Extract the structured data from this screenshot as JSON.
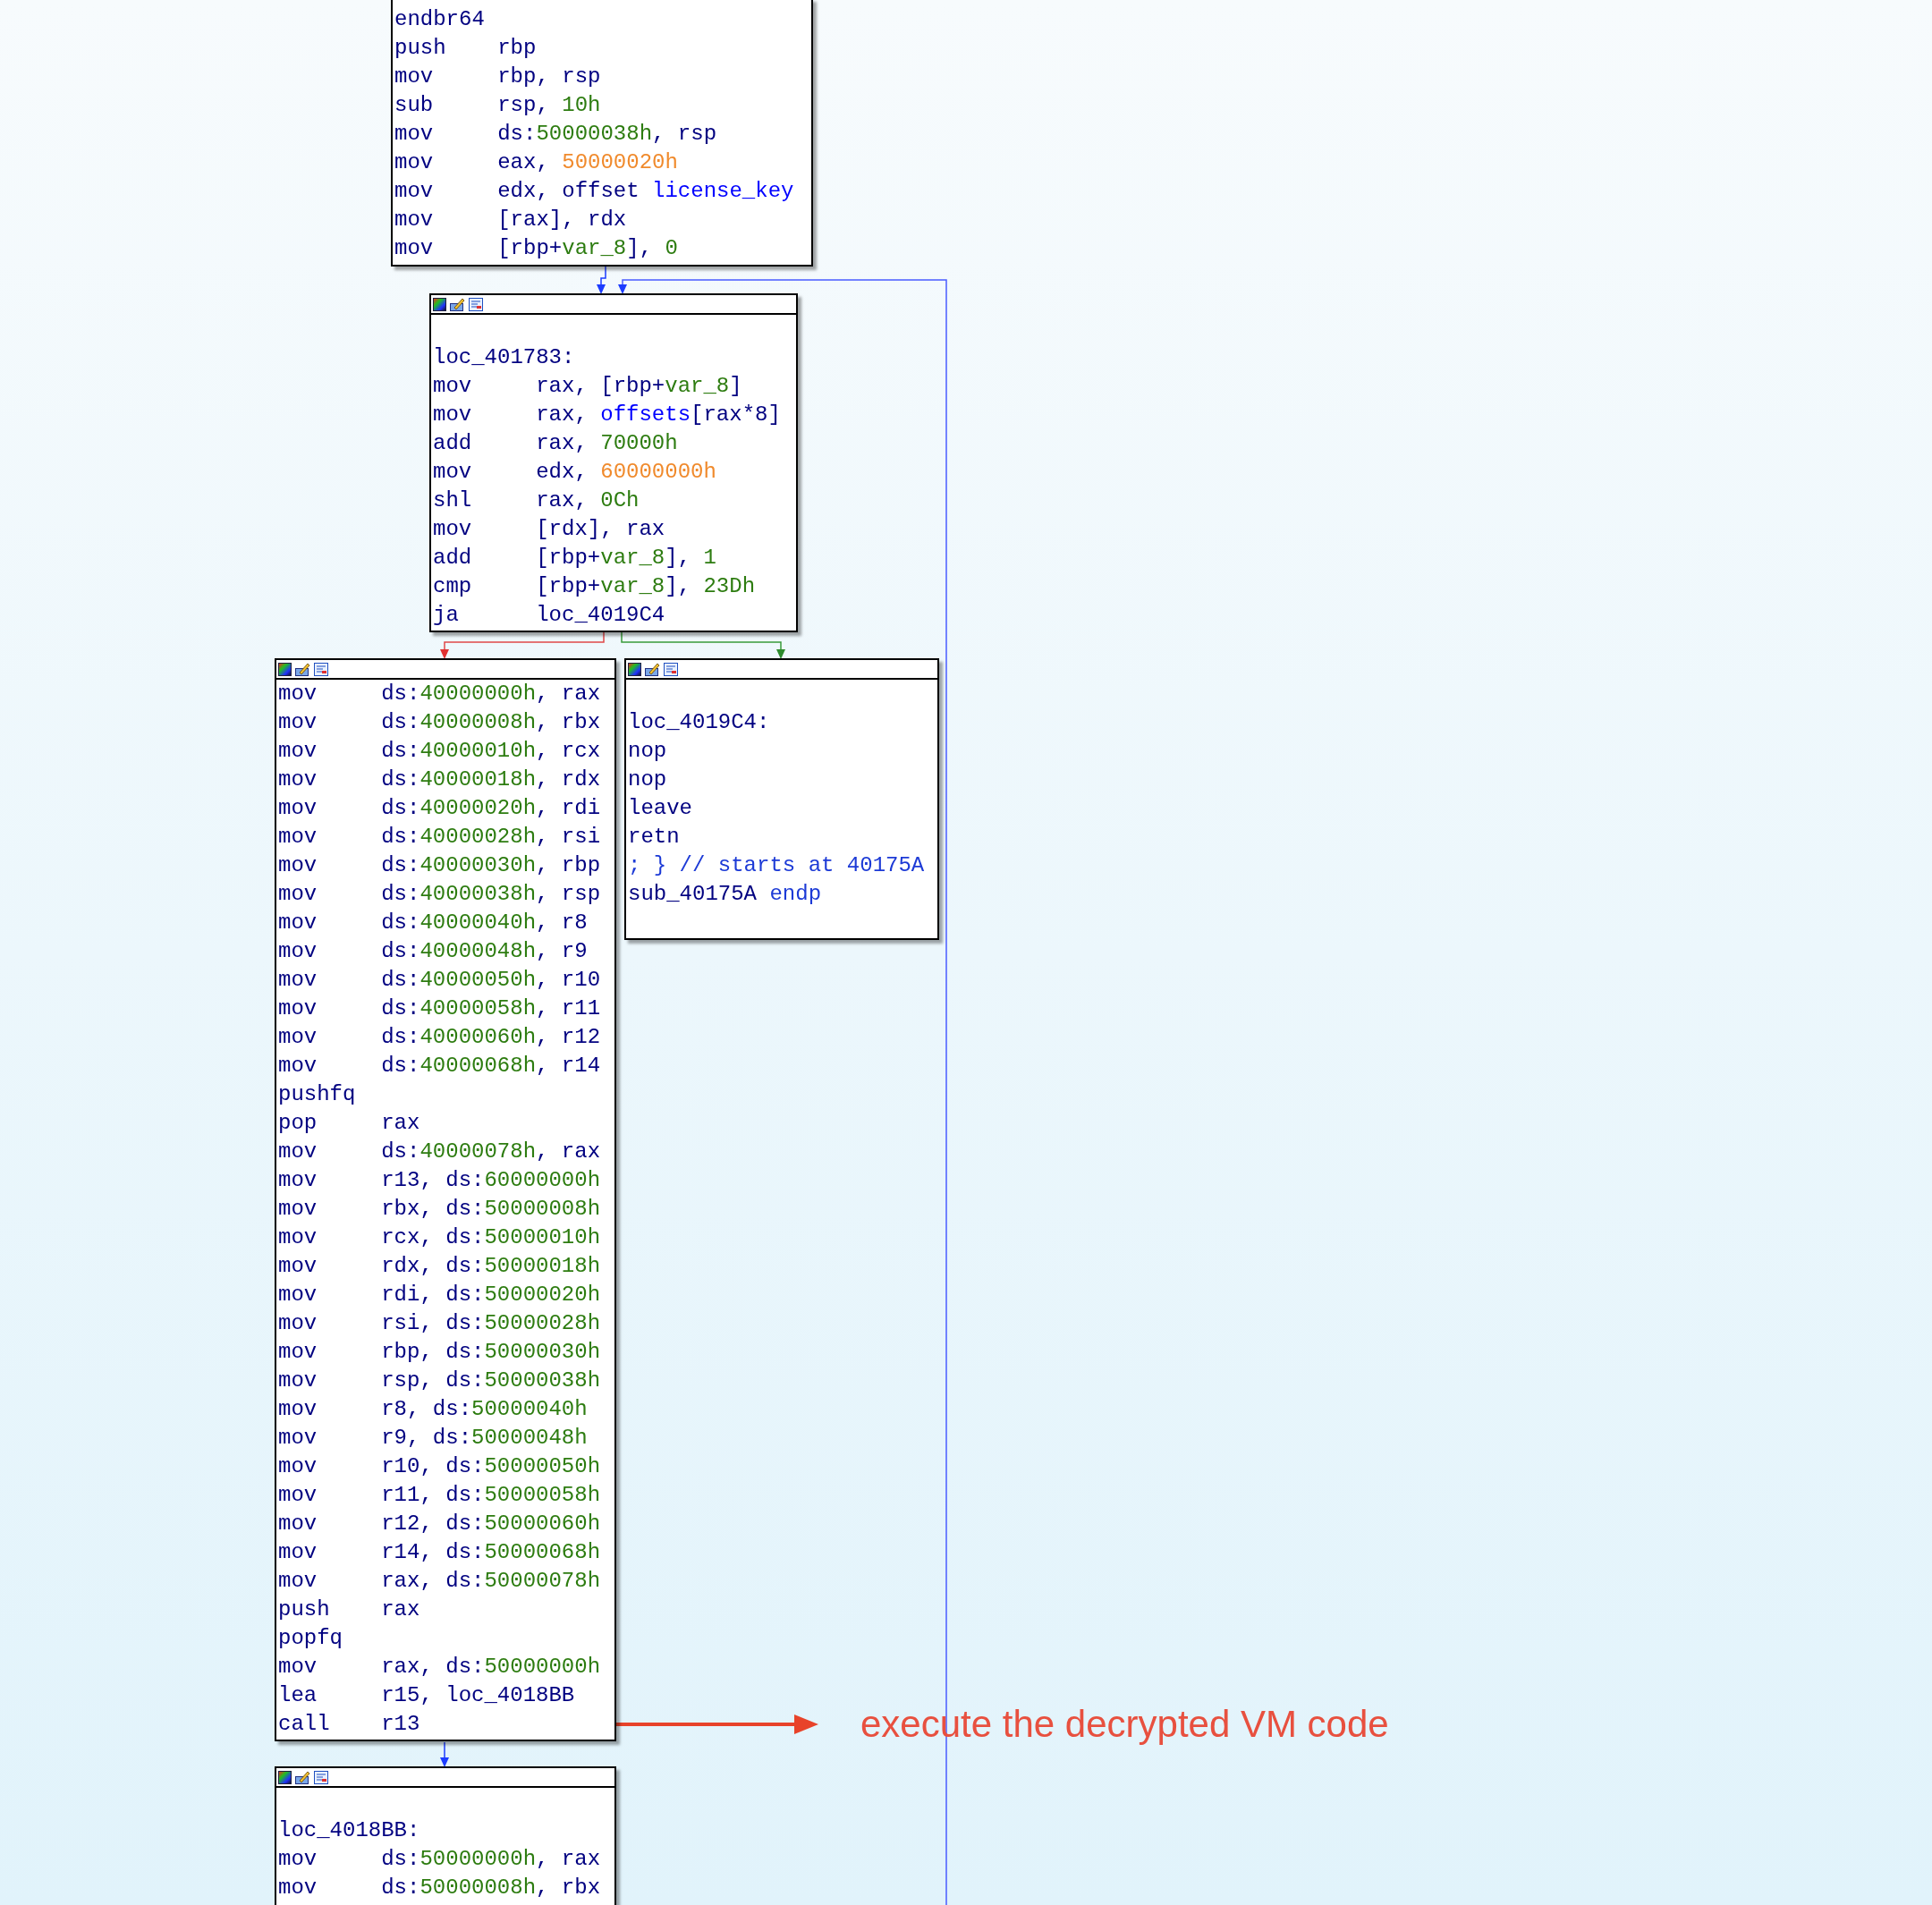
{
  "blocks": [
    {
      "toolbar": false,
      "lines": [
        {
          "kind": "instr",
          "mnemonic": "endbr64"
        },
        {
          "kind": "instr",
          "mnemonic": "push",
          "parts": [
            {
              "kind": "plain",
              "text": "rbp"
            }
          ]
        },
        {
          "kind": "instr",
          "mnemonic": "mov",
          "parts": [
            {
              "kind": "plain",
              "text": "rbp, rsp"
            }
          ]
        },
        {
          "kind": "instr",
          "mnemonic": "sub",
          "parts": [
            {
              "kind": "plain",
              "text": "rsp, "
            },
            {
              "kind": "num",
              "text": "10h"
            }
          ]
        },
        {
          "kind": "instr",
          "mnemonic": "mov",
          "parts": [
            {
              "kind": "plain",
              "text": "ds:"
            },
            {
              "kind": "num",
              "text": "50000038h"
            },
            {
              "kind": "plain",
              "text": ", rsp"
            }
          ]
        },
        {
          "kind": "instr",
          "mnemonic": "mov",
          "parts": [
            {
              "kind": "plain",
              "text": "eax, "
            },
            {
              "kind": "addr",
              "text": "50000020h"
            }
          ]
        },
        {
          "kind": "instr",
          "mnemonic": "mov",
          "parts": [
            {
              "kind": "plain",
              "text": "edx, offset "
            },
            {
              "kind": "name",
              "text": "license_key"
            }
          ]
        },
        {
          "kind": "instr",
          "mnemonic": "mov",
          "parts": [
            {
              "kind": "plain",
              "text": "[rax], rdx"
            }
          ]
        },
        {
          "kind": "instr",
          "mnemonic": "mov",
          "parts": [
            {
              "kind": "plain",
              "text": "[rbp+"
            },
            {
              "kind": "num",
              "text": "var_8"
            },
            {
              "kind": "plain",
              "text": "], "
            },
            {
              "kind": "num",
              "text": "0"
            }
          ]
        }
      ]
    },
    {
      "toolbar": true,
      "lines": [
        {
          "kind": "blank"
        },
        {
          "kind": "label",
          "parts": [
            {
              "kind": "plain",
              "text": "loc_401783:"
            }
          ]
        },
        {
          "kind": "instr",
          "mnemonic": "mov",
          "parts": [
            {
              "kind": "plain",
              "text": "rax, [rbp+"
            },
            {
              "kind": "num",
              "text": "var_8"
            },
            {
              "kind": "plain",
              "text": "]"
            }
          ]
        },
        {
          "kind": "instr",
          "mnemonic": "mov",
          "parts": [
            {
              "kind": "plain",
              "text": "rax, "
            },
            {
              "kind": "name",
              "text": "offsets"
            },
            {
              "kind": "plain",
              "text": "[rax*8]"
            }
          ]
        },
        {
          "kind": "instr",
          "mnemonic": "add",
          "parts": [
            {
              "kind": "plain",
              "text": "rax, "
            },
            {
              "kind": "num",
              "text": "70000h"
            }
          ]
        },
        {
          "kind": "instr",
          "mnemonic": "mov",
          "parts": [
            {
              "kind": "plain",
              "text": "edx, "
            },
            {
              "kind": "addr",
              "text": "60000000h"
            }
          ]
        },
        {
          "kind": "instr",
          "mnemonic": "shl",
          "parts": [
            {
              "kind": "plain",
              "text": "rax, "
            },
            {
              "kind": "num",
              "text": "0Ch"
            }
          ]
        },
        {
          "kind": "instr",
          "mnemonic": "mov",
          "parts": [
            {
              "kind": "plain",
              "text": "[rdx], rax"
            }
          ]
        },
        {
          "kind": "instr",
          "mnemonic": "add",
          "parts": [
            {
              "kind": "plain",
              "text": "[rbp+"
            },
            {
              "kind": "num",
              "text": "var_8"
            },
            {
              "kind": "plain",
              "text": "], "
            },
            {
              "kind": "num",
              "text": "1"
            }
          ]
        },
        {
          "kind": "instr",
          "mnemonic": "cmp",
          "parts": [
            {
              "kind": "plain",
              "text": "[rbp+"
            },
            {
              "kind": "num",
              "text": "var_8"
            },
            {
              "kind": "plain",
              "text": "], "
            },
            {
              "kind": "num",
              "text": "23Dh"
            }
          ]
        },
        {
          "kind": "instr",
          "mnemonic": "ja",
          "parts": [
            {
              "kind": "plain",
              "text": "loc_4019C4"
            }
          ]
        }
      ]
    },
    {
      "toolbar": true,
      "lines": [
        {
          "kind": "instr",
          "mnemonic": "mov",
          "parts": [
            {
              "kind": "plain",
              "text": "ds:"
            },
            {
              "kind": "num",
              "text": "40000000h"
            },
            {
              "kind": "plain",
              "text": ", rax"
            }
          ]
        },
        {
          "kind": "instr",
          "mnemonic": "mov",
          "parts": [
            {
              "kind": "plain",
              "text": "ds:"
            },
            {
              "kind": "num",
              "text": "40000008h"
            },
            {
              "kind": "plain",
              "text": ", rbx"
            }
          ]
        },
        {
          "kind": "instr",
          "mnemonic": "mov",
          "parts": [
            {
              "kind": "plain",
              "text": "ds:"
            },
            {
              "kind": "num",
              "text": "40000010h"
            },
            {
              "kind": "plain",
              "text": ", rcx"
            }
          ]
        },
        {
          "kind": "instr",
          "mnemonic": "mov",
          "parts": [
            {
              "kind": "plain",
              "text": "ds:"
            },
            {
              "kind": "num",
              "text": "40000018h"
            },
            {
              "kind": "plain",
              "text": ", rdx"
            }
          ]
        },
        {
          "kind": "instr",
          "mnemonic": "mov",
          "parts": [
            {
              "kind": "plain",
              "text": "ds:"
            },
            {
              "kind": "num",
              "text": "40000020h"
            },
            {
              "kind": "plain",
              "text": ", rdi"
            }
          ]
        },
        {
          "kind": "instr",
          "mnemonic": "mov",
          "parts": [
            {
              "kind": "plain",
              "text": "ds:"
            },
            {
              "kind": "num",
              "text": "40000028h"
            },
            {
              "kind": "plain",
              "text": ", rsi"
            }
          ]
        },
        {
          "kind": "instr",
          "mnemonic": "mov",
          "parts": [
            {
              "kind": "plain",
              "text": "ds:"
            },
            {
              "kind": "num",
              "text": "40000030h"
            },
            {
              "kind": "plain",
              "text": ", rbp"
            }
          ]
        },
        {
          "kind": "instr",
          "mnemonic": "mov",
          "parts": [
            {
              "kind": "plain",
              "text": "ds:"
            },
            {
              "kind": "num",
              "text": "40000038h"
            },
            {
              "kind": "plain",
              "text": ", rsp"
            }
          ]
        },
        {
          "kind": "instr",
          "mnemonic": "mov",
          "parts": [
            {
              "kind": "plain",
              "text": "ds:"
            },
            {
              "kind": "num",
              "text": "40000040h"
            },
            {
              "kind": "plain",
              "text": ", r8"
            }
          ]
        },
        {
          "kind": "instr",
          "mnemonic": "mov",
          "parts": [
            {
              "kind": "plain",
              "text": "ds:"
            },
            {
              "kind": "num",
              "text": "40000048h"
            },
            {
              "kind": "plain",
              "text": ", r9"
            }
          ]
        },
        {
          "kind": "instr",
          "mnemonic": "mov",
          "parts": [
            {
              "kind": "plain",
              "text": "ds:"
            },
            {
              "kind": "num",
              "text": "40000050h"
            },
            {
              "kind": "plain",
              "text": ", r10"
            }
          ]
        },
        {
          "kind": "instr",
          "mnemonic": "mov",
          "parts": [
            {
              "kind": "plain",
              "text": "ds:"
            },
            {
              "kind": "num",
              "text": "40000058h"
            },
            {
              "kind": "plain",
              "text": ", r11"
            }
          ]
        },
        {
          "kind": "instr",
          "mnemonic": "mov",
          "parts": [
            {
              "kind": "plain",
              "text": "ds:"
            },
            {
              "kind": "num",
              "text": "40000060h"
            },
            {
              "kind": "plain",
              "text": ", r12"
            }
          ]
        },
        {
          "kind": "instr",
          "mnemonic": "mov",
          "parts": [
            {
              "kind": "plain",
              "text": "ds:"
            },
            {
              "kind": "num",
              "text": "40000068h"
            },
            {
              "kind": "plain",
              "text": ", r14"
            }
          ]
        },
        {
          "kind": "instr",
          "mnemonic": "pushfq"
        },
        {
          "kind": "instr",
          "mnemonic": "pop",
          "parts": [
            {
              "kind": "plain",
              "text": "rax"
            }
          ]
        },
        {
          "kind": "instr",
          "mnemonic": "mov",
          "parts": [
            {
              "kind": "plain",
              "text": "ds:"
            },
            {
              "kind": "num",
              "text": "40000078h"
            },
            {
              "kind": "plain",
              "text": ", rax"
            }
          ]
        },
        {
          "kind": "instr",
          "mnemonic": "mov",
          "parts": [
            {
              "kind": "plain",
              "text": "r13, ds:"
            },
            {
              "kind": "num",
              "text": "60000000h"
            }
          ]
        },
        {
          "kind": "instr",
          "mnemonic": "mov",
          "parts": [
            {
              "kind": "plain",
              "text": "rbx, ds:"
            },
            {
              "kind": "num",
              "text": "50000008h"
            }
          ]
        },
        {
          "kind": "instr",
          "mnemonic": "mov",
          "parts": [
            {
              "kind": "plain",
              "text": "rcx, ds:"
            },
            {
              "kind": "num",
              "text": "50000010h"
            }
          ]
        },
        {
          "kind": "instr",
          "mnemonic": "mov",
          "parts": [
            {
              "kind": "plain",
              "text": "rdx, ds:"
            },
            {
              "kind": "num",
              "text": "50000018h"
            }
          ]
        },
        {
          "kind": "instr",
          "mnemonic": "mov",
          "parts": [
            {
              "kind": "plain",
              "text": "rdi, ds:"
            },
            {
              "kind": "num",
              "text": "50000020h"
            }
          ]
        },
        {
          "kind": "instr",
          "mnemonic": "mov",
          "parts": [
            {
              "kind": "plain",
              "text": "rsi, ds:"
            },
            {
              "kind": "num",
              "text": "50000028h"
            }
          ]
        },
        {
          "kind": "instr",
          "mnemonic": "mov",
          "parts": [
            {
              "kind": "plain",
              "text": "rbp, ds:"
            },
            {
              "kind": "num",
              "text": "50000030h"
            }
          ]
        },
        {
          "kind": "instr",
          "mnemonic": "mov",
          "parts": [
            {
              "kind": "plain",
              "text": "rsp, ds:"
            },
            {
              "kind": "num",
              "text": "50000038h"
            }
          ]
        },
        {
          "kind": "instr",
          "mnemonic": "mov",
          "parts": [
            {
              "kind": "plain",
              "text": "r8, ds:"
            },
            {
              "kind": "num",
              "text": "50000040h"
            }
          ]
        },
        {
          "kind": "instr",
          "mnemonic": "mov",
          "parts": [
            {
              "kind": "plain",
              "text": "r9, ds:"
            },
            {
              "kind": "num",
              "text": "50000048h"
            }
          ]
        },
        {
          "kind": "instr",
          "mnemonic": "mov",
          "parts": [
            {
              "kind": "plain",
              "text": "r10, ds:"
            },
            {
              "kind": "num",
              "text": "50000050h"
            }
          ]
        },
        {
          "kind": "instr",
          "mnemonic": "mov",
          "parts": [
            {
              "kind": "plain",
              "text": "r11, ds:"
            },
            {
              "kind": "num",
              "text": "50000058h"
            }
          ]
        },
        {
          "kind": "instr",
          "mnemonic": "mov",
          "parts": [
            {
              "kind": "plain",
              "text": "r12, ds:"
            },
            {
              "kind": "num",
              "text": "50000060h"
            }
          ]
        },
        {
          "kind": "instr",
          "mnemonic": "mov",
          "parts": [
            {
              "kind": "plain",
              "text": "r14, ds:"
            },
            {
              "kind": "num",
              "text": "50000068h"
            }
          ]
        },
        {
          "kind": "instr",
          "mnemonic": "mov",
          "parts": [
            {
              "kind": "plain",
              "text": "rax, ds:"
            },
            {
              "kind": "num",
              "text": "50000078h"
            }
          ]
        },
        {
          "kind": "instr",
          "mnemonic": "push",
          "parts": [
            {
              "kind": "plain",
              "text": "rax"
            }
          ]
        },
        {
          "kind": "instr",
          "mnemonic": "popfq"
        },
        {
          "kind": "instr",
          "mnemonic": "mov",
          "parts": [
            {
              "kind": "plain",
              "text": "rax, ds:"
            },
            {
              "kind": "num",
              "text": "50000000h"
            }
          ]
        },
        {
          "kind": "instr",
          "mnemonic": "lea",
          "parts": [
            {
              "kind": "plain",
              "text": "r15, loc_4018BB"
            }
          ]
        },
        {
          "kind": "instr",
          "mnemonic": "call",
          "parts": [
            {
              "kind": "plain",
              "text": "r13"
            }
          ]
        }
      ]
    },
    {
      "toolbar": true,
      "lines": [
        {
          "kind": "blank"
        },
        {
          "kind": "label",
          "parts": [
            {
              "kind": "plain",
              "text": "loc_4019C4:"
            }
          ]
        },
        {
          "kind": "instr",
          "mnemonic": "nop"
        },
        {
          "kind": "instr",
          "mnemonic": "nop"
        },
        {
          "kind": "instr",
          "mnemonic": "leave"
        },
        {
          "kind": "instr",
          "mnemonic": "retn"
        },
        {
          "kind": "label",
          "parts": [
            {
              "kind": "comment",
              "text": "; } // starts at 40175A"
            }
          ]
        },
        {
          "kind": "label",
          "parts": [
            {
              "kind": "plain",
              "text": "sub_40175A "
            },
            {
              "kind": "comment",
              "text": "endp"
            }
          ]
        }
      ]
    },
    {
      "toolbar": true,
      "lines": [
        {
          "kind": "blank"
        },
        {
          "kind": "label",
          "parts": [
            {
              "kind": "plain",
              "text": "loc_4018BB:"
            }
          ]
        },
        {
          "kind": "instr",
          "mnemonic": "mov",
          "parts": [
            {
              "kind": "plain",
              "text": "ds:"
            },
            {
              "kind": "num",
              "text": "50000000h"
            },
            {
              "kind": "plain",
              "text": ", rax"
            }
          ]
        },
        {
          "kind": "instr",
          "mnemonic": "mov",
          "parts": [
            {
              "kind": "plain",
              "text": "ds:"
            },
            {
              "kind": "num",
              "text": "50000008h"
            },
            {
              "kind": "plain",
              "text": ", rbx"
            }
          ]
        }
      ]
    }
  ],
  "annotation": {
    "text": "execute the decrypted VM code"
  }
}
